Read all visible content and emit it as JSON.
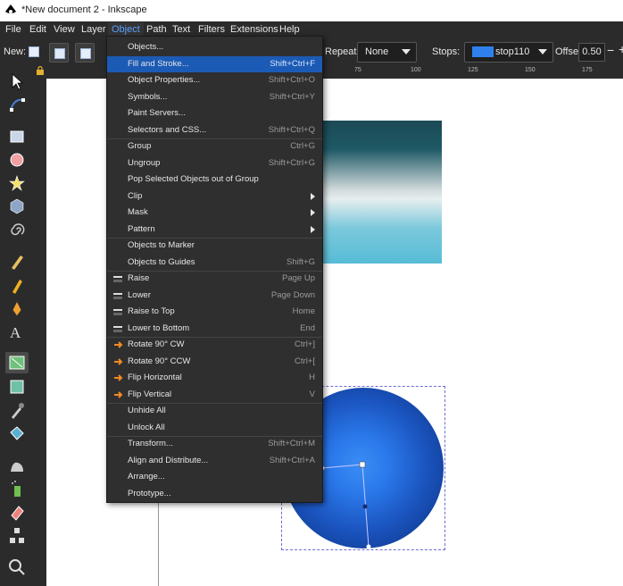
{
  "title": "*New document 2 - Inkscape",
  "menu": [
    "File",
    "Edit",
    "View",
    "Layer",
    "Object",
    "Path",
    "Text",
    "Filters",
    "Extensions",
    "Help"
  ],
  "menu_active": "Object",
  "toolbar": {
    "new_label": "New:",
    "repeat_label": "Repeat:",
    "repeat_value": "None",
    "stops_label": "Stops:",
    "stop_value": "stop110",
    "stop_color": "#2f80ed",
    "offset_label": "Offset:",
    "offset_value": "0.50",
    "minus": "−",
    "plus": "+"
  },
  "ruler": [
    "75",
    "100",
    "125",
    "150",
    "175"
  ],
  "object_menu": [
    {
      "label": "Objects...",
      "shortcut": ""
    },
    {
      "label": "Fill and Stroke...",
      "shortcut": "Shift+Ctrl+F",
      "highlighted": true
    },
    {
      "label": "Object Properties...",
      "shortcut": "Shift+Ctrl+O"
    },
    {
      "label": "Symbols...",
      "shortcut": "Shift+Ctrl+Y"
    },
    {
      "label": "Paint Servers...",
      "shortcut": ""
    },
    {
      "label": "Selectors and CSS...",
      "shortcut": "Shift+Ctrl+Q"
    },
    {
      "label": "Group",
      "shortcut": "Ctrl+G"
    },
    {
      "label": "Ungroup",
      "shortcut": "Shift+Ctrl+G"
    },
    {
      "label": "Pop Selected Objects out of Group",
      "shortcut": ""
    },
    {
      "label": "Clip",
      "shortcut": "",
      "submenu": true
    },
    {
      "label": "Mask",
      "shortcut": "",
      "submenu": true
    },
    {
      "label": "Pattern",
      "shortcut": "",
      "submenu": true
    },
    {
      "label": "Objects to Marker",
      "shortcut": ""
    },
    {
      "label": "Objects to Guides",
      "shortcut": "Shift+G"
    },
    {
      "label": "Raise",
      "shortcut": "Page Up",
      "icon": "raise-icon"
    },
    {
      "label": "Lower",
      "shortcut": "Page Down",
      "icon": "lower-icon"
    },
    {
      "label": "Raise to Top",
      "shortcut": "Home",
      "icon": "raise-to-top-icon"
    },
    {
      "label": "Lower to Bottom",
      "shortcut": "End",
      "icon": "lower-to-bottom-icon"
    },
    {
      "label": "Rotate 90° CW",
      "shortcut": "Ctrl+]",
      "icon": "rotate-cw-icon"
    },
    {
      "label": "Rotate 90° CCW",
      "shortcut": "Ctrl+[",
      "icon": "rotate-ccw-icon"
    },
    {
      "label": "Flip Horizontal",
      "shortcut": "H",
      "icon": "flip-horizontal-icon"
    },
    {
      "label": "Flip Vertical",
      "shortcut": "V",
      "icon": "flip-vertical-icon"
    },
    {
      "label": "Unhide All",
      "shortcut": ""
    },
    {
      "label": "Unlock All",
      "shortcut": ""
    },
    {
      "label": "Transform...",
      "shortcut": "Shift+Ctrl+M"
    },
    {
      "label": "Align and Distribute...",
      "shortcut": "Shift+Ctrl+A"
    },
    {
      "label": "Arrange...",
      "shortcut": ""
    },
    {
      "label": "Prototype...",
      "shortcut": ""
    }
  ]
}
